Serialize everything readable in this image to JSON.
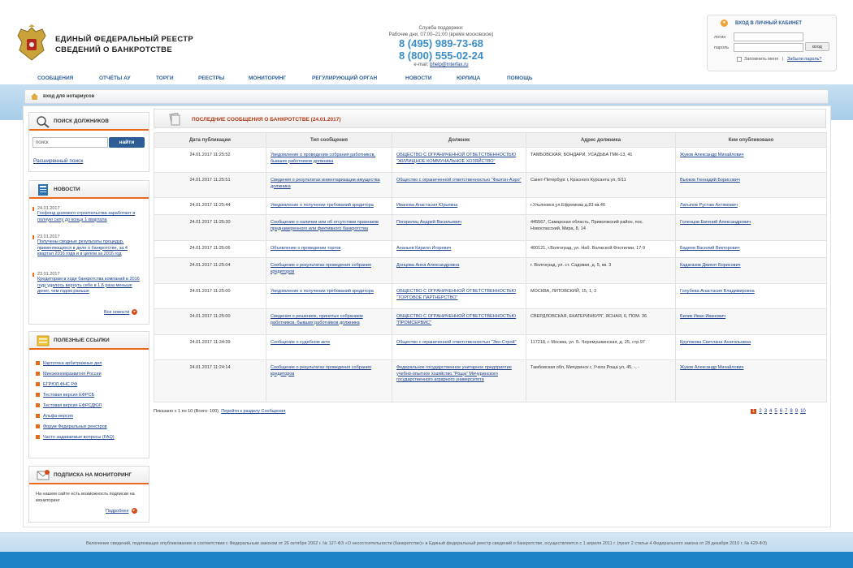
{
  "header": {
    "title_line1": "ЕДИНЫЙ ФЕДЕРАЛЬНЫЙ РЕЕСТР",
    "title_line2": "СВЕДЕНИЙ О БАНКРОТСТВЕ",
    "support_label": "Служба поддержки:",
    "work_hours": "Рабочие дни, 07:00–21:00 (время московское)",
    "phone1": "8 (495) 989-73-68",
    "phone2": "8 (800) 555-02-24",
    "email_label": "e-mail:",
    "email": "bhelp@interfax.ru"
  },
  "login": {
    "title": "ВХОД В ЛИЧНЫЙ КАБИНЕТ",
    "login_label": "логин",
    "password_label": "пароль",
    "submit": "вход",
    "remember": "Запомнить меня",
    "separator": "|",
    "forgot": "Забыли пароль?"
  },
  "nav": {
    "items": [
      "СООБЩЕНИЯ",
      "ОТЧЁТЫ АУ",
      "ТОРГИ",
      "РЕЕСТРЫ",
      "МОНИТОРИНГ",
      "РЕГУЛИРУЮЩИЙ ОРГАН",
      "НОВОСТИ",
      "ЮРЛИЦА",
      "ПОМОЩЬ"
    ]
  },
  "breadcrumb": {
    "label": "вход для нотариусов"
  },
  "search_widget": {
    "title": "ПОИСК ДОЛЖНИКОВ",
    "input_value": "поиск",
    "button": "найти",
    "advanced": "Расширенный поиск"
  },
  "news_widget": {
    "title": "НОВОСТИ",
    "items": [
      {
        "date": "24.01.2017",
        "text": "Госфонд долевого строительства заработает в полную силу до конца 1 квартала"
      },
      {
        "date": "23.01.2017",
        "text": "Получены сводные результаты процедур, применяющихся в деле о банкротстве, за 4 квартал 2016 года и в целом за 2016 год"
      },
      {
        "date": "23.01.2017",
        "text": "Кредиторам в ходе банкротства компаний в 2016 году удалось вернуть себе в 1,6 раза меньше денег, чем годом раньше"
      }
    ],
    "all_news": "Все новости"
  },
  "links_widget": {
    "title": "ПОЛЕЗНЫЕ ССЫЛКИ",
    "items": [
      "Картотека арбитражных дел",
      "Минэкономразвития России",
      "ЕГРЮЛ ФНС РФ",
      "Тестовая версия ЕФРСБ",
      "Тестовая версия ЕФРСДЮЛ",
      "Альфа-версия",
      "Форум Федеральных реестров",
      "Часто задаваемые вопросы (FAQ)"
    ]
  },
  "subscribe_widget": {
    "title": "ПОДПИСКА НА МОНИТОРИНГ",
    "text": "На нашем сайте есть возможность подписки на мониторинг",
    "more": "Подробнее"
  },
  "messages": {
    "title": "ПОСЛЕДНИЕ СООБЩЕНИЯ О БАНКРОТСТВЕ (24.01.2017)",
    "columns": [
      "Дата публикации",
      "Тип сообщения",
      "Должник",
      "Адрес должника",
      "Кем опубликовано"
    ],
    "rows": [
      [
        "24.01.2017 11:25:52",
        "Уведомление о проведении собрания работников, бывших работников должника",
        "ОБЩЕСТВО С ОГРАНИЧЕННОЙ ОТВЕТСТВЕННОСТЬЮ \"ЖИЛИЩНОЕ КОММУНАЛЬНОЕ ХОЗЯЙСТВО\"",
        "ТАМБОВСКАЯ, БОНДАРИ, УСАДЬБА ГМК-13, 41",
        "Жуков Александр Михайлович"
      ],
      [
        "24.01.2017 11:25:51",
        "Сведения о результатах инвентаризации имущества должника",
        "Общество с ограниченной ответственностью \"Фаэтон-Аэро\"",
        "Санкт-Петербург г, Красного Курсанта ул, 5/11",
        "Вьюков Геннадий Борисович"
      ],
      [
        "24.01.2017 11:25:44",
        "Уведомление о получении требований кредитора",
        "Иванова Анастасия Юрьевна",
        "г.Ульяновск ул.Ефремова д.83 кв.46",
        "Латыпов Рустам Ахтямович"
      ],
      [
        "24.01.2017 11:25:30",
        "Сообщение о наличии или об отсутствии признаков преднамеренного или фиктивного банкротства",
        "Погорелец Андрей Васильевич",
        "445567, Самарская область, Приволжский район, пос. Новоспасский, Мира, 8, 14",
        "Голенцов Евгений Александрович"
      ],
      [
        "24.01.2017 11:25:06",
        "Объявление о проведении торгов",
        "Ананьев Кирилл Игоревич",
        "400121, г.Волгоград, ул. Наб. Волжской Флотилии, 17-9",
        "Бадеев Василий Викторович"
      ],
      [
        "24.01.2017 11:25:04",
        "Сообщение о результатах проведения собрания кредиторов",
        "Донцова Анна Александровна",
        "г. Волгоград, ул. ст. Садовая, д. 5, кв. 3",
        "Кадагазов Джигит Борисович"
      ],
      [
        "24.01.2017 11:25:00",
        "Уведомление о получении требований кредитора",
        "ОБЩЕСТВО С ОГРАНИЧЕННОЙ ОТВЕТСТВЕННОСТЬЮ \"ТОРГОВОЕ ПАРТНЕРСТВО\"",
        "МОСКВА, ЛИТОВСКИЙ, 15, 1, 2",
        "Голубева Анастасия Владимировна"
      ],
      [
        "24.01.2017 11:25:00",
        "Сведения о решениях, принятых собранием работников, бывших работников должника",
        "ОБЩЕСТВО С ОГРАНИЧЕННОЙ ОТВЕТСТВЕННОСТЬЮ \"ПРОМСЕРВИС\"",
        "СВЕРДЛОВСКАЯ, ЕКАТЕРИНБУРГ, ЯСНАЯ, 6, ПОМ. 36",
        "Билик Иван Иванович"
      ],
      [
        "24.01.2017 11:24:39",
        "Сообщение о судебном акте",
        "Общество с ограниченной ответственностью \"Эко-Строй\"",
        "117218, г. Москва, ул. Б. Черемушкинская, д. 25, стр.97",
        "Крупякова Светлана Анатольевна"
      ],
      [
        "24.01.2017 11:24:14",
        "Сообщение о результатах проведения собрания кредиторов",
        "Федеральное государственное унитарное предприятие учебно-опытное хозяйство \"Роща\" Мичуринского государственного аграрного университета",
        "Тамбовская обл, Мичуринск г, Учхоз Роща ул, 45, -, -",
        "Жуков Александр Михайлович"
      ]
    ],
    "shown_info": "Показано с 1 по 10 (Всего: 100)",
    "goto_section": "Перейти к разделу Сообщения",
    "pages": [
      "1",
      "2",
      "3",
      "4",
      "5",
      "6",
      "7",
      "8",
      "9",
      "10"
    ]
  },
  "footer": {
    "text": "Включение сведений, подлежащих опубликованию в соответствии с Федеральным законом от 26 октября 2002 г. № 127-ФЗ «О несостоятельности (банкротстве)» в Единый федеральный реестр сведений о банкротстве, осуществляется с 1 апреля 2011 г. (пункт 2 статьи 4 Федерального закона от 28 декабря 2010 г. № 429-ФЗ)"
  },
  "colors": {
    "accent": "#e96a1b",
    "link": "#1a3f8a",
    "phone": "#3b8dc6",
    "band": "#a8cde9"
  },
  "icons": [
    "emblem-icon",
    "lock-icon",
    "home-icon",
    "magnifier-icon",
    "newspaper-icon",
    "links-icon",
    "mail-icon",
    "documents-icon",
    "arrow-right-icon"
  ]
}
